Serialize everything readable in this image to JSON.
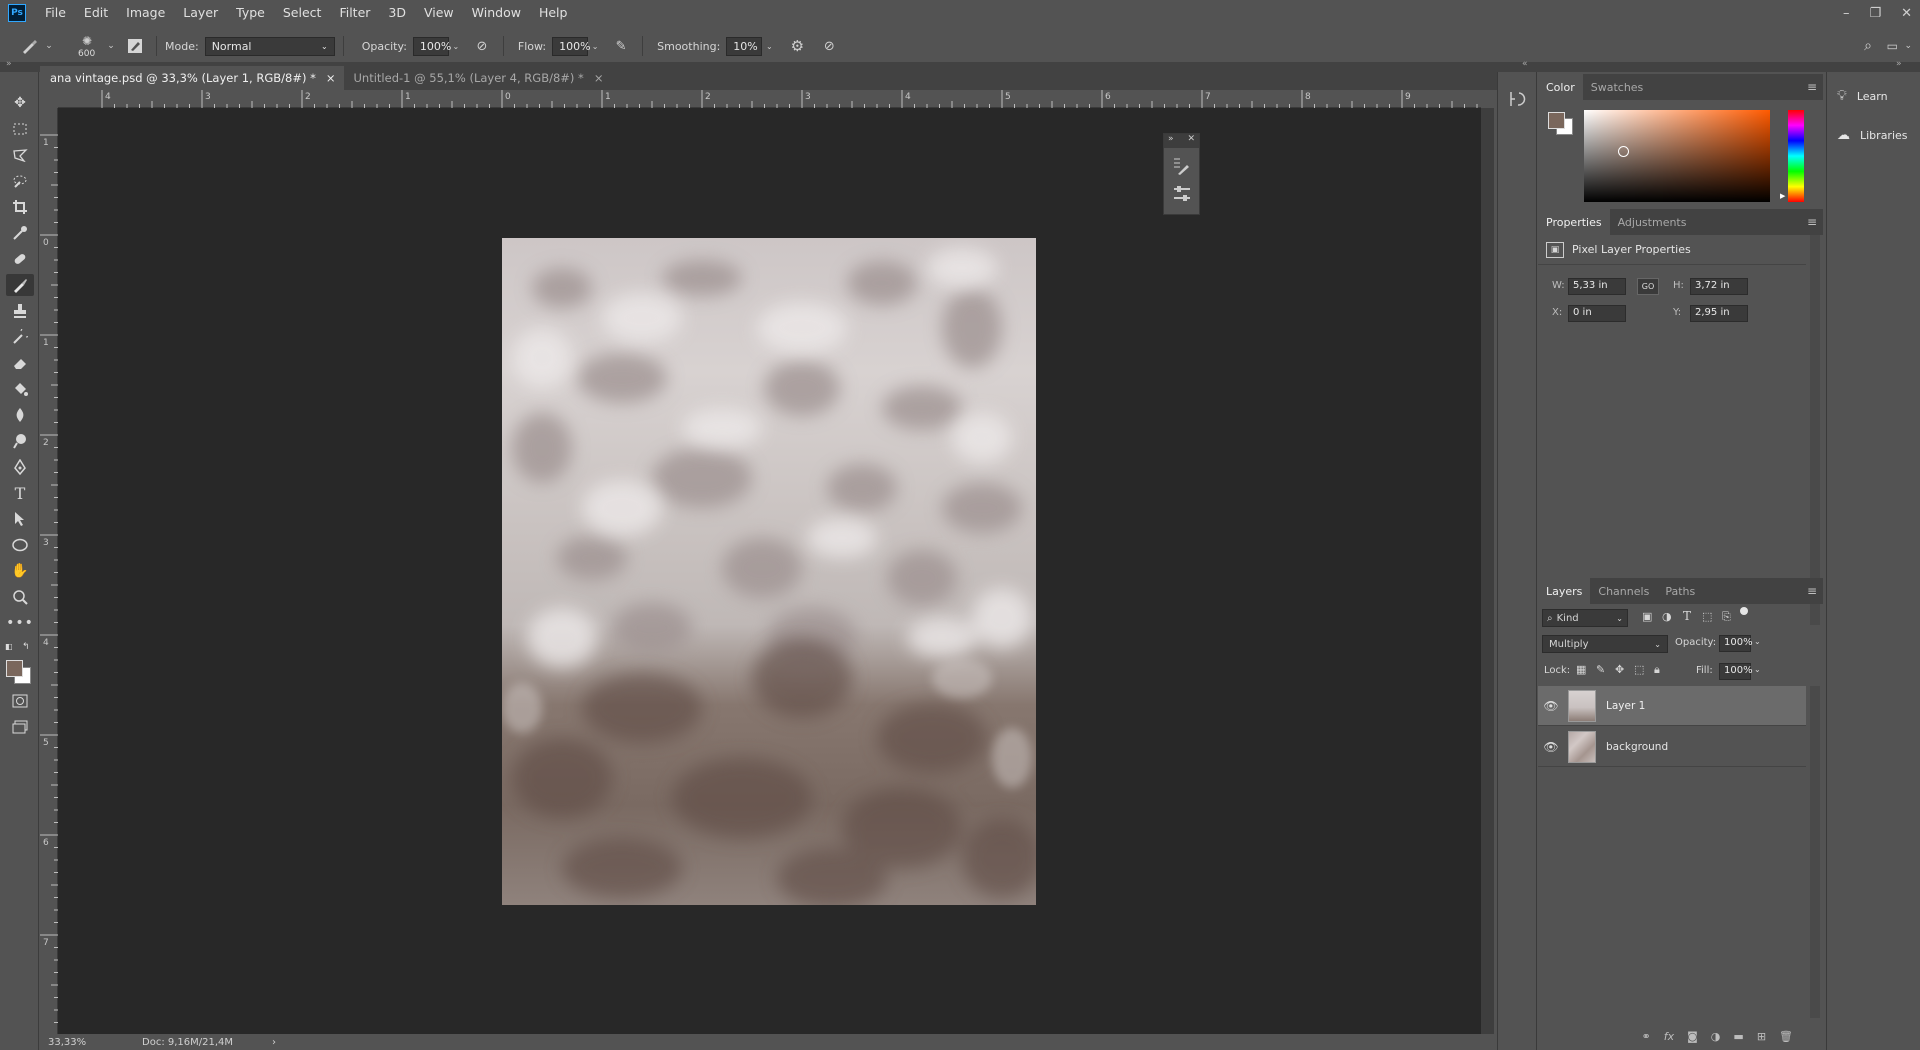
{
  "app": {
    "logo": "Ps"
  },
  "menu": [
    "File",
    "Edit",
    "Image",
    "Layer",
    "Type",
    "Select",
    "Filter",
    "3D",
    "View",
    "Window",
    "Help"
  ],
  "window_controls": {
    "minimize": "–",
    "restore": "❐",
    "close": "✕"
  },
  "options": {
    "brush_size": "600",
    "mode_label": "Mode:",
    "mode_value": "Normal",
    "opacity_label": "Opacity:",
    "opacity_value": "100%",
    "flow_label": "Flow:",
    "flow_value": "100%",
    "smoothing_label": "Smoothing:",
    "smoothing_value": "10%"
  },
  "tabs": [
    {
      "label": "ana vintage.psd @ 33,3% (Layer 1, RGB/8#) *",
      "close": "×"
    },
    {
      "label": "Untitled-1 @ 55,1% (Layer 4, RGB/8#) *",
      "close": "×"
    }
  ],
  "ruler_h": [
    "4",
    "3",
    "2",
    "1",
    "0",
    "1",
    "2",
    "3",
    "4",
    "5",
    "6",
    "7",
    "8",
    "9"
  ],
  "ruler_v": [
    "1",
    "0",
    "1",
    "2",
    "3",
    "4",
    "5",
    "6",
    "7"
  ],
  "status": {
    "zoom": "33,33%",
    "doc": "Doc: 9,16M/21,4M",
    "arrow": "›"
  },
  "colors": {
    "foreground": "#7a675c",
    "background": "#ffffff",
    "accent": "#31a8ff",
    "canvas_bg": "#282828",
    "panel_bg": "#535353"
  },
  "color_panel": {
    "tabs": [
      "Color",
      "Swatches"
    ]
  },
  "properties": {
    "tabs": [
      "Properties",
      "Adjustments"
    ],
    "header": "Pixel Layer Properties",
    "w_label": "W:",
    "w_value": "5,33 in",
    "h_label": "H:",
    "h_value": "3,72 in",
    "x_label": "X:",
    "x_value": "0 in",
    "y_label": "Y:",
    "y_value": "2,95 in",
    "link_icon": "GO"
  },
  "layers_panel": {
    "tabs": [
      "Layers",
      "Channels",
      "Paths"
    ],
    "filter_label": "Kind",
    "blend_mode": "Multiply",
    "opacity_label": "Opacity:",
    "opacity_value": "100%",
    "lock_label": "Lock:",
    "fill_label": "Fill:",
    "fill_value": "100%",
    "layers": [
      {
        "name": "Layer 1",
        "visible": true,
        "selected": true
      },
      {
        "name": "background",
        "visible": true,
        "selected": false
      }
    ]
  },
  "learn_panel": {
    "learn": "Learn",
    "libraries": "Libraries"
  }
}
